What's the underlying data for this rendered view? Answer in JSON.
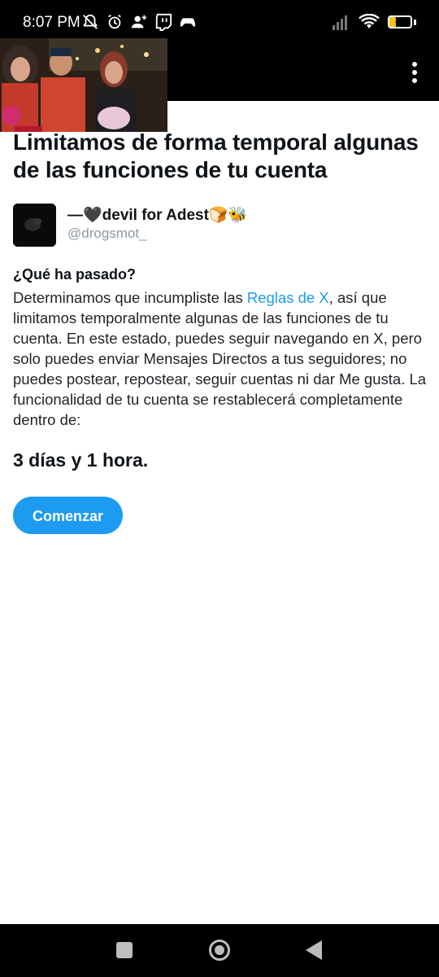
{
  "status_bar": {
    "time": "8:07 PM",
    "battery_level": "31",
    "battery_fraction": 0.31,
    "icons": [
      "muted-bell-icon",
      "alarm-icon",
      "add-person-icon",
      "twitch-icon",
      "gamepad-icon",
      "signal-icon",
      "wifi-icon",
      "battery-icon"
    ]
  },
  "app_bar": {
    "menu_icon": "overflow-menu-icon"
  },
  "main": {
    "title": "Limitamos de forma temporal algunas de las funciones de tu cuenta",
    "account": {
      "display_name": "—🖤devil for Adest🍞🐝",
      "handle": "@drogsmot_"
    },
    "what_heading": "¿Qué ha pasado?",
    "body_before_link": "Determinamos que incumpliste las ",
    "body_link": "Reglas de X",
    "body_after_link": ", así que limitamos temporalmente algunas de las funciones de tu cuenta. En este estado, puedes seguir navegando en X, pero solo puedes enviar Mensajes Directos a tus seguidores; no puedes postear, repostear, seguir cuentas ni dar Me gusta. La funcionalidad de tu cuenta se restablecerá completamente dentro de:",
    "duration": "3 días y 1 hora.",
    "start_button": "Comenzar"
  },
  "colors": {
    "accent": "#1d9bf0",
    "title": "#0f1419",
    "handle": "#8b98a5",
    "bars": "#000000"
  }
}
